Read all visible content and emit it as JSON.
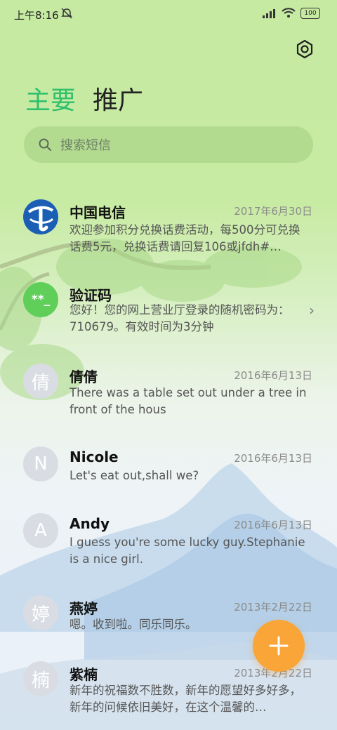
{
  "status": {
    "time": "上午8:16",
    "battery": "100"
  },
  "tabs": {
    "main": "主要",
    "promo": "推广"
  },
  "search": {
    "placeholder": "搜索短信"
  },
  "messages": [
    {
      "name": "中国电信",
      "date": "2017年6月30日",
      "preview": "欢迎参加积分兑换话费活动，每500分可兑换话费5元，兑换话费请回复106或jfdh#…",
      "avatar": "telecom-logo-icon"
    },
    {
      "name": "验证码",
      "date": "",
      "preview": "您好！您的网上营业厅登录的随机密码为：710679。有效时间为3分钟",
      "avatar": "**_"
    },
    {
      "name": "倩倩",
      "date": "2016年6月13日",
      "preview": "There was a table set out under a tree in front of the hous",
      "avatar": "倩"
    },
    {
      "name": "Nicole",
      "date": "2016年6月13日",
      "preview": "Let's eat out,shall we?",
      "avatar": "N"
    },
    {
      "name": "Andy",
      "date": "2016年6月13日",
      "preview": "I guess you're some lucky guy.Stephanie is a nice girl.",
      "avatar": "A"
    },
    {
      "name": "燕婷",
      "date": "2013年2月22日",
      "preview": "嗯。收到啦。同乐同乐。",
      "avatar": "婷"
    },
    {
      "name": "紫楠",
      "date": "2013年2月22日",
      "preview": "新年的祝福数不胜数，新年的愿望好多好多，新年的问候依旧美好，在这个温馨的…",
      "avatar": "楠"
    }
  ],
  "colors": {
    "accent": "#2fbf6d",
    "fab": "#f9a537",
    "verify_avatar": "#5fcf5a"
  },
  "icons": {
    "settings": "settings-hexagon-icon",
    "search": "search-icon",
    "compose": "plus-icon",
    "chevron": "chevron-right-icon"
  }
}
